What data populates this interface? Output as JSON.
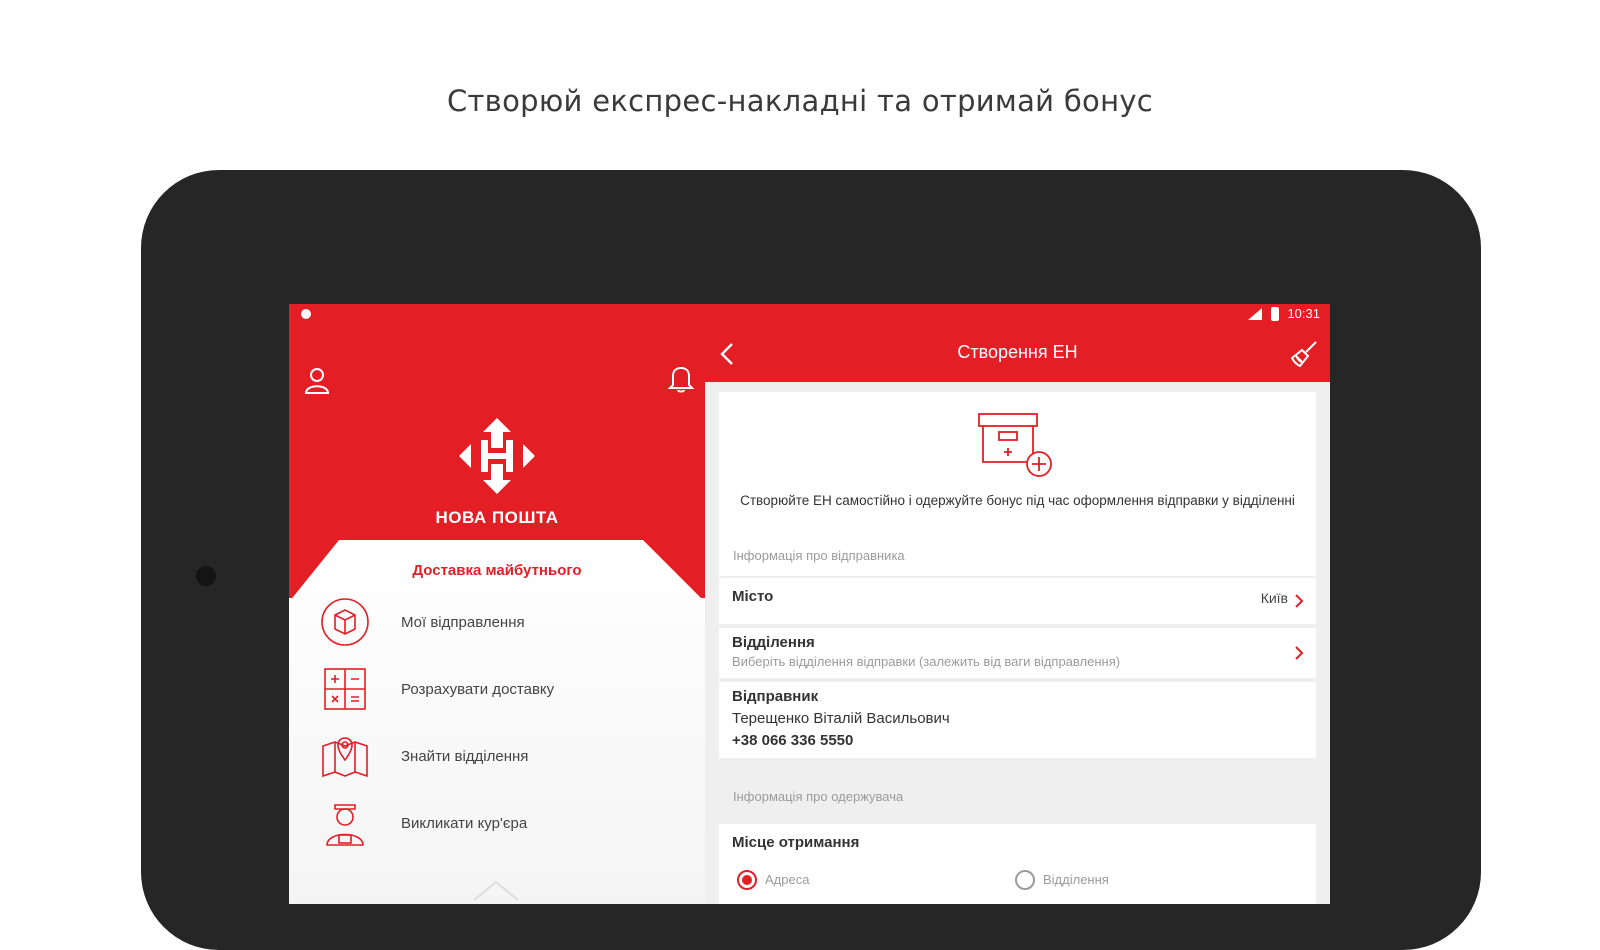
{
  "headline": "Створюй експрес-накладні та отримай бонус",
  "status_bar": {
    "time": "10:31"
  },
  "left_panel": {
    "brand_name": "НОВА ПОШТА",
    "tagline": "Доставка майбутнього",
    "menu": [
      {
        "label": "Мої відправлення",
        "icon": "parcel-icon"
      },
      {
        "label": "Розрахувати доставку",
        "icon": "calculator-icon"
      },
      {
        "label": "Знайти відділення",
        "icon": "map-pin-icon"
      },
      {
        "label": "Викликати кур'єра",
        "icon": "courier-icon"
      }
    ]
  },
  "app_bar": {
    "title": "Створення ЕН"
  },
  "form": {
    "hero_text": "Створюйте ЕН самостійно і одержуйте бонус під час оформлення відправки у відділенні",
    "sender_section_caption": "Інформація про відправника",
    "city": {
      "label": "Місто",
      "value": "Київ"
    },
    "branch": {
      "label": "Відділення",
      "placeholder": "Виберіть відділення відправки (залежить від ваги відправлення)"
    },
    "sender": {
      "label": "Відправник",
      "name": "Терещенко Віталій Васильович",
      "phone": "+38 066 336 5550"
    },
    "recipient_section_caption": "Інформація про одержувача",
    "receive_place": {
      "label": "Місце отримання",
      "options": [
        "Адреса",
        "Відділення"
      ],
      "selected": "Адреса"
    }
  },
  "colors": {
    "brand_red": "#e31e24",
    "tablet_frame": "#262626"
  }
}
